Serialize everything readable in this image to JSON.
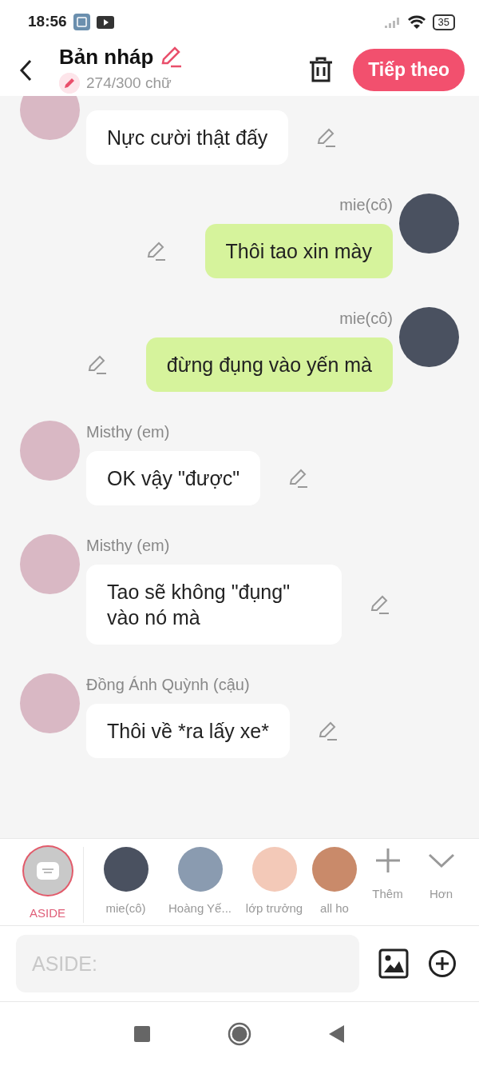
{
  "status_bar": {
    "time": "18:56",
    "battery": "35"
  },
  "header": {
    "title": "Bản nháp",
    "counter": "274/300 chữ",
    "next_button": "Tiếp theo"
  },
  "messages": [
    {
      "kind": "received",
      "text": "Nực cười thật đấy"
    },
    {
      "kind": "sent",
      "sender": "mie(cô)",
      "text": "Thôi tao xin mày"
    },
    {
      "kind": "sent",
      "sender": "mie(cô)",
      "text": "đừng đụng vào yến mà"
    },
    {
      "kind": "received",
      "sender": "Misthy (em)",
      "text": "OK vậy \"được\""
    },
    {
      "kind": "received",
      "sender": "Misthy (em)",
      "text": "Tao sẽ không \"đụng\" vào nó mà"
    },
    {
      "kind": "received",
      "sender": "Đồng Ánh Quỳnh (cậu)",
      "text": "Thôi về *ra lấy xe*"
    }
  ],
  "characters": [
    {
      "kind": "aside",
      "label": "ASIDE",
      "selected": true
    },
    {
      "kind": "character",
      "label": "mie(cô)",
      "selected": false
    },
    {
      "kind": "character",
      "label": "Hoàng Yế...",
      "selected": false
    },
    {
      "kind": "character",
      "label": "lớp trưởng",
      "selected": false
    },
    {
      "kind": "character",
      "label": "all ho",
      "selected": false
    }
  ],
  "strip_actions": [
    {
      "kind": "add",
      "label": "Thêm"
    },
    {
      "kind": "more",
      "label": "Hơn"
    }
  ],
  "composer": {
    "placeholder": "ASIDE:"
  }
}
